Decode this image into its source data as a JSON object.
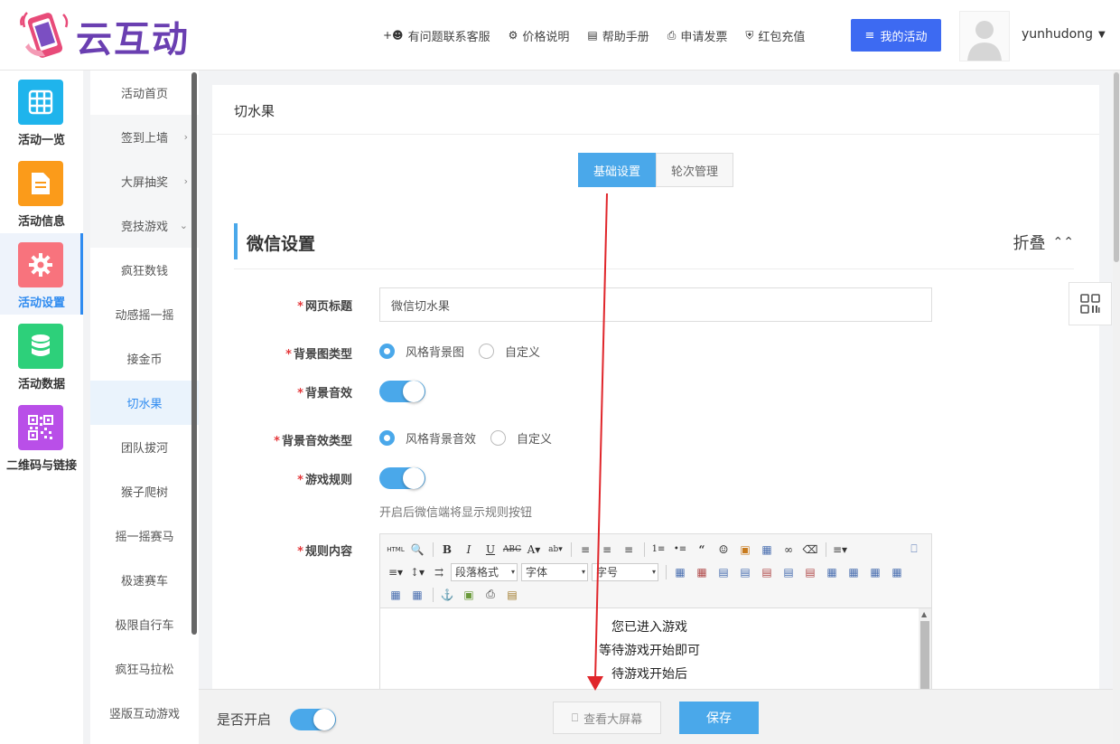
{
  "brand": {
    "name": "云互动"
  },
  "header": {
    "nav": [
      {
        "label": "有问题联系客服",
        "icon": "add-user-icon"
      },
      {
        "label": "价格说明",
        "icon": "gear-icon"
      },
      {
        "label": "帮助手册",
        "icon": "book-icon"
      },
      {
        "label": "申请发票",
        "icon": "printer-icon"
      },
      {
        "label": "红包充值",
        "icon": "shield-icon"
      }
    ],
    "my_activity": "我的活动",
    "username": "yunhudong"
  },
  "iconbar": [
    {
      "label": "活动一览",
      "color": "#1fb4ec"
    },
    {
      "label": "活动信息",
      "color": "#fb9b1a"
    },
    {
      "label": "活动设置",
      "color": "#f8737d"
    },
    {
      "label": "活动数据",
      "color": "#2dd07a"
    },
    {
      "label": "二维码与链接",
      "color": "#b94fe8"
    }
  ],
  "submenu": [
    {
      "label": "活动首页"
    },
    {
      "label": "签到上墙"
    },
    {
      "label": "大屏抽奖"
    },
    {
      "label": "竞技游戏"
    },
    {
      "label": "疯狂数钱"
    },
    {
      "label": "动感摇一摇"
    },
    {
      "label": "接金币"
    },
    {
      "label": "切水果"
    },
    {
      "label": "团队拔河"
    },
    {
      "label": "猴子爬树"
    },
    {
      "label": "摇一摇赛马"
    },
    {
      "label": "极速赛车"
    },
    {
      "label": "极限自行车"
    },
    {
      "label": "疯狂马拉松"
    },
    {
      "label": "竖版互动游戏"
    }
  ],
  "panel": {
    "title": "切水果",
    "tabs": [
      "基础设置",
      "轮次管理"
    ],
    "section_title": "微信设置",
    "fold_label": "折叠",
    "fields": {
      "page_title_label": "网页标题",
      "page_title_value": "微信切水果",
      "bg_type_label": "背景图类型",
      "bg_type_opt1": "风格背景图",
      "bg_type_opt2": "自定义",
      "bg_sound_label": "背景音效",
      "bg_sound_type_label": "背景音效类型",
      "bg_sound_opt1": "风格背景音效",
      "bg_sound_opt2": "自定义",
      "rules_label": "游戏规则",
      "rules_hint": "开启后微信端将显示规则按钮",
      "rules_content_label": "规则内容"
    },
    "editor": {
      "paragraph_format": "段落格式",
      "font": "字体",
      "font_size": "字号",
      "lines": [
        "您已进入游戏",
        "等待游戏开始即可",
        "待游戏开始后"
      ]
    }
  },
  "bottom": {
    "enable_label": "是否开启",
    "preview": "查看大屏幕",
    "save": "保存"
  }
}
